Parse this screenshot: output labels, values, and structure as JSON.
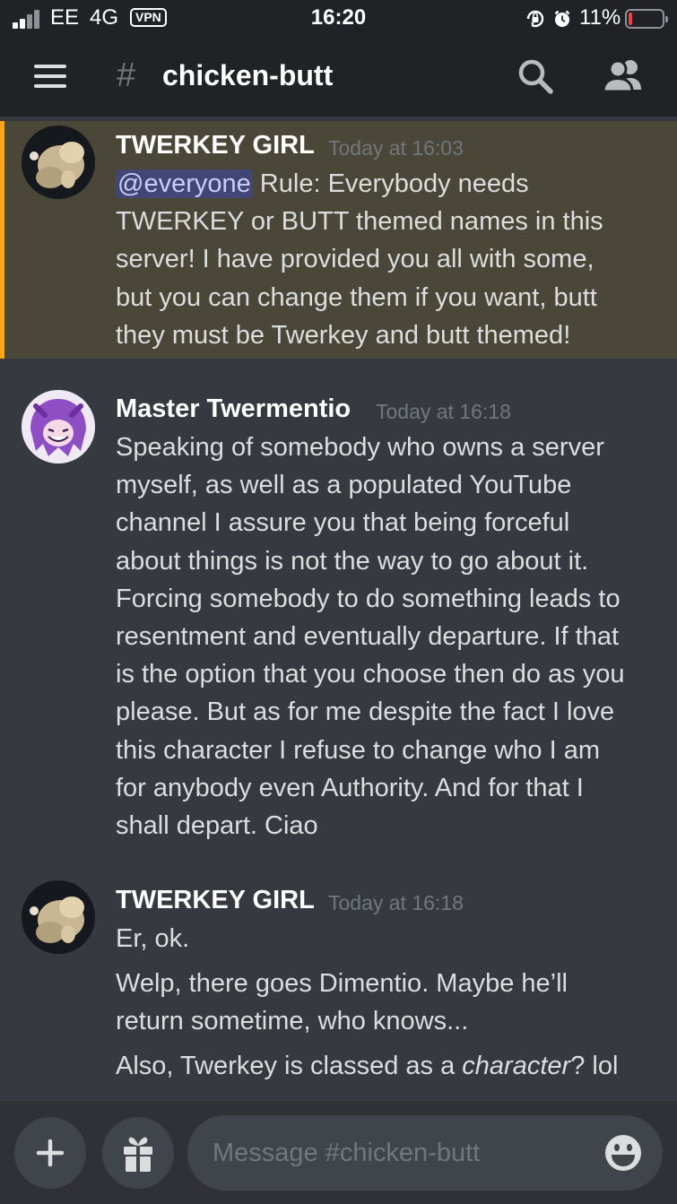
{
  "status_bar": {
    "carrier": "EE",
    "network": "4G",
    "vpn": "VPN",
    "time": "16:20",
    "battery_percent": "11%",
    "battery_level": 0.11,
    "icons": [
      "signal-icon",
      "orientation-lock-icon",
      "alarm-icon",
      "battery-icon"
    ]
  },
  "header": {
    "channel_prefix": "#",
    "channel_name": "chicken-butt",
    "icons": [
      "hamburger-menu-icon",
      "search-icon",
      "members-icon"
    ]
  },
  "messages": [
    {
      "author": "TWERKEY GIRL",
      "timestamp": "Today at 16:03",
      "highlighted": true,
      "mention": "@everyone",
      "lines": [
        " Rule: Everybody needs",
        "TWERKEY or BUTT themed names in this",
        "server! I have provided you all with some,",
        "but you can change them if you want, butt",
        "they must be Twerkey and butt themed!"
      ]
    },
    {
      "author": "Master Twermentio",
      "timestamp": "Today at 16:18",
      "lines": [
        "Speaking of somebody who owns a server",
        "myself, as well as a populated YouTube",
        "channel I assure you that being forceful",
        "about things is not the way to go about it.",
        "Forcing somebody to do something leads to",
        "resentment and eventually departure. If that",
        "is the option that you choose then do as you",
        "please. But as for me despite the fact I love",
        "this character I refuse to change who I am",
        "for anybody even Authority. And for that I",
        "shall depart. Ciao"
      ]
    },
    {
      "author": "TWERKEY GIRL",
      "timestamp": "Today at 16:18",
      "lines": [
        "Er, ok."
      ],
      "followups": [
        {
          "lines": [
            "Welp, there goes Dimentio. Maybe he’ll",
            "return sometime, who knows..."
          ]
        },
        {
          "before": "Also, Twerkey is classed as a ",
          "italic": "character",
          "after": "? lol"
        }
      ]
    }
  ],
  "composer": {
    "placeholder": "Message #chicken-butt",
    "value": "",
    "icons": [
      "plus-icon",
      "gift-icon",
      "emoji-icon"
    ]
  },
  "colors": {
    "background": "#36393f",
    "header": "#202225",
    "composer_bar": "#2f3136",
    "input": "#40444b",
    "mention_highlight": "#4a4638",
    "mention_bar": "#faa61a",
    "mention_pill": "#414675",
    "timestamp": "#72767d"
  }
}
